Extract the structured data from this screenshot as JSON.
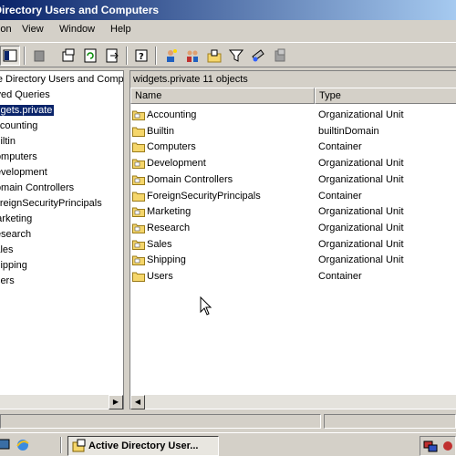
{
  "window": {
    "title": "Active Directory Users and Computers"
  },
  "menubar": {
    "items": [
      "Action",
      "View",
      "Window",
      "Help"
    ]
  },
  "toolbar": {
    "icons": [
      "console-tree-icon",
      "delete-icon",
      "properties-icon",
      "refresh-icon",
      "export-list-icon",
      "help-icon",
      "new-user-icon",
      "new-group-icon",
      "new-ou-icon",
      "filter-icon",
      "find-icon",
      "add-to-group-icon"
    ]
  },
  "tree": {
    "root": "Active Directory Users and Computers",
    "items": [
      "Saved Queries",
      "widgets.private",
      "Accounting",
      "Builtin",
      "Computers",
      "Development",
      "Domain Controllers",
      "ForeignSecurityPrincipals",
      "Marketing",
      "Research",
      "Sales",
      "Shipping",
      "Users"
    ],
    "selected_index": 1
  },
  "list": {
    "header": "widgets.private    11 objects",
    "columns": [
      "Name",
      "Type"
    ],
    "rows": [
      {
        "name": "Accounting",
        "type": "Organizational Unit"
      },
      {
        "name": "Builtin",
        "type": "builtinDomain"
      },
      {
        "name": "Computers",
        "type": "Container"
      },
      {
        "name": "Development",
        "type": "Organizational Unit"
      },
      {
        "name": "Domain Controllers",
        "type": "Organizational Unit"
      },
      {
        "name": "ForeignSecurityPrincipals",
        "type": "Container"
      },
      {
        "name": "Marketing",
        "type": "Organizational Unit"
      },
      {
        "name": "Research",
        "type": "Organizational Unit"
      },
      {
        "name": "Sales",
        "type": "Organizational Unit"
      },
      {
        "name": "Shipping",
        "type": "Organizational Unit"
      },
      {
        "name": "Users",
        "type": "Container"
      }
    ]
  },
  "taskbar": {
    "active_task": "Active Directory User..."
  },
  "colors": {
    "titlebar_start": "#0a246a",
    "titlebar_end": "#a6caf0",
    "selection": "#0a246a",
    "folder": "#f5d66b"
  }
}
